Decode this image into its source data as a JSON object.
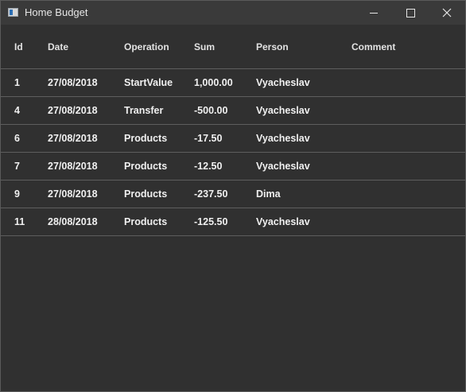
{
  "window": {
    "title": "Home Budget"
  },
  "table": {
    "columns": [
      "Id",
      "Date",
      "Operation",
      "Sum",
      "Person",
      "Comment"
    ],
    "rows": [
      {
        "id": "1",
        "date": "27/08/2018",
        "operation": "StartValue",
        "sum": "1,000.00",
        "person": "Vyacheslav",
        "comment": ""
      },
      {
        "id": "4",
        "date": "27/08/2018",
        "operation": "Transfer",
        "sum": "-500.00",
        "person": "Vyacheslav",
        "comment": ""
      },
      {
        "id": "6",
        "date": "27/08/2018",
        "operation": "Products",
        "sum": "-17.50",
        "person": "Vyacheslav",
        "comment": ""
      },
      {
        "id": "7",
        "date": "27/08/2018",
        "operation": "Products",
        "sum": "-12.50",
        "person": "Vyacheslav",
        "comment": ""
      },
      {
        "id": "9",
        "date": "27/08/2018",
        "operation": "Products",
        "sum": "-237.50",
        "person": "Dima",
        "comment": ""
      },
      {
        "id": "11",
        "date": "28/08/2018",
        "operation": "Products",
        "sum": "-125.50",
        "person": "Vyacheslav",
        "comment": ""
      }
    ]
  },
  "icons": {
    "app": "app-window-icon",
    "minimize": "minimize-icon",
    "maximize": "maximize-icon",
    "close": "close-icon"
  },
  "colors": {
    "background": "#303030",
    "titlebar": "#3a3a3a",
    "text": "#f0f0f0",
    "row_divider": "#5e5e5e"
  }
}
